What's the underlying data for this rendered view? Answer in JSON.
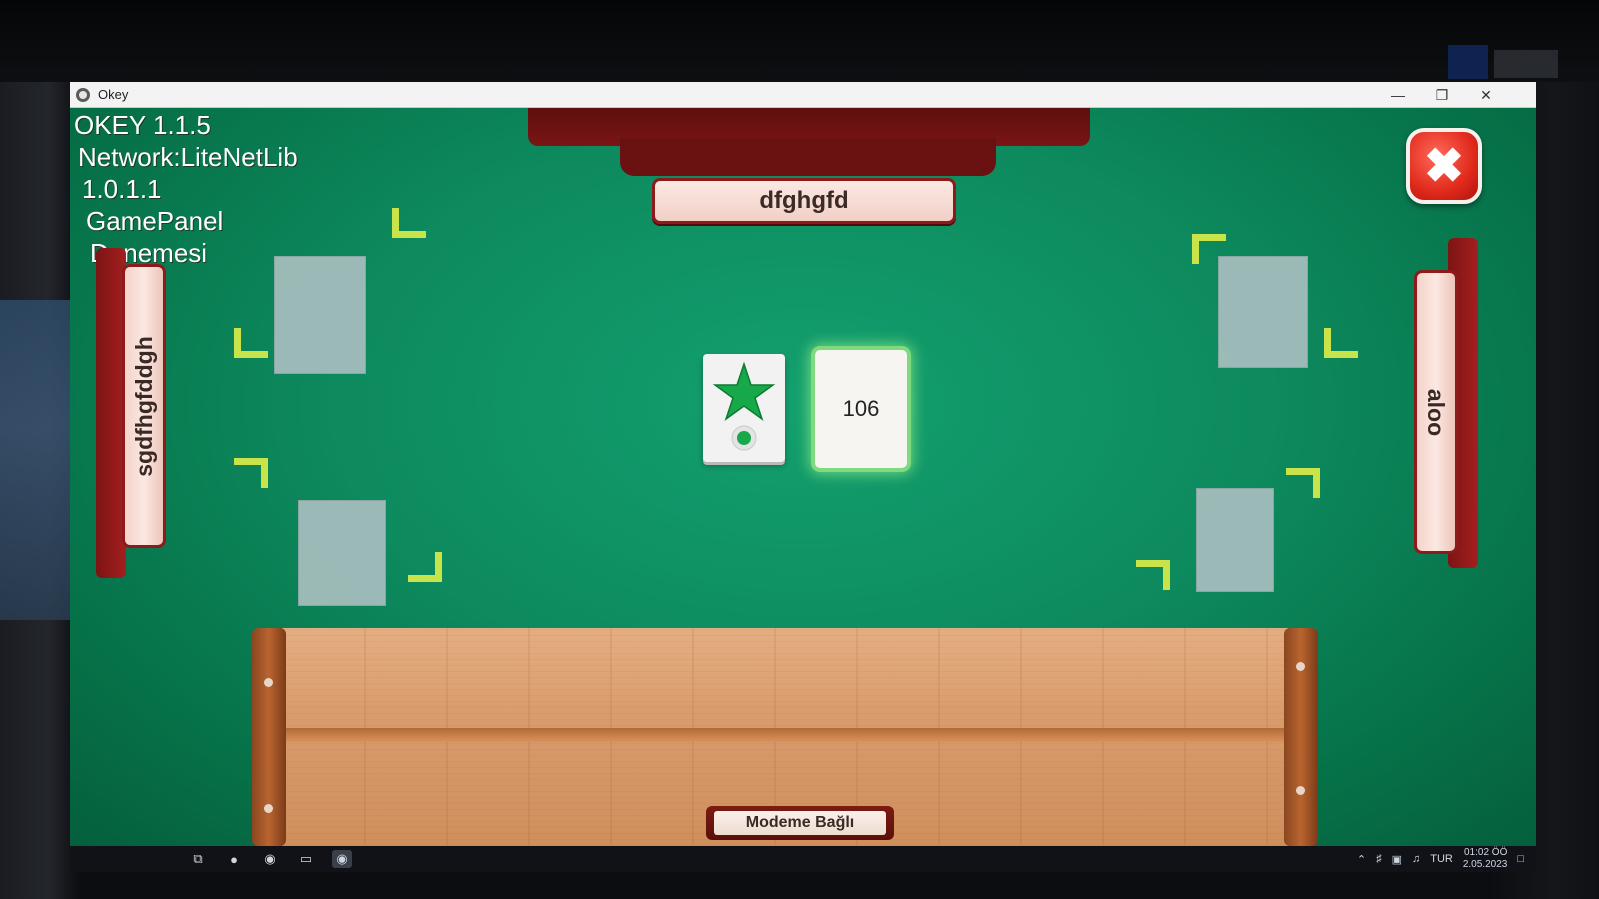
{
  "window": {
    "title": "Okey",
    "min_icon": "minimize-icon",
    "max_icon": "restore-icon",
    "close_icon": "close-icon"
  },
  "info_lines": [
    "OKEY 1.1.5",
    "Network:LiteNetLib",
    "1.0.1.1",
    "GamePanel",
    "Denemesi"
  ],
  "players": {
    "top": "dfghgfd",
    "left": "sgdfhgfddgh",
    "right": "aloo"
  },
  "indicator": {
    "icon": "star-icon",
    "dot_icon": "circle-icon",
    "color": "#17a84a"
  },
  "remaining_tiles": "106",
  "status_label": "Modeme Bağlı",
  "colors": {
    "felt": "#0d8a5e",
    "frame": "#8c1b1b",
    "highlight": "#c9e34a",
    "close": "#e02a1c"
  },
  "taskbar": {
    "icons": [
      "windows-start-icon",
      "chrome-icon",
      "app-icon",
      "folder-icon",
      "okey-app-icon"
    ],
    "tray": [
      "chevron-up-icon",
      "language-icon",
      "network-icon",
      "volume-icon"
    ],
    "lang": "TUR",
    "time": "01:02 ÖÖ",
    "date": "2.05.2023"
  }
}
